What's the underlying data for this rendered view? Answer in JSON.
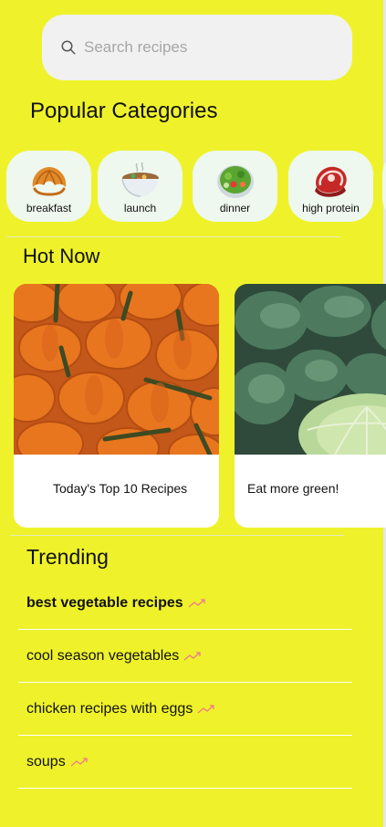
{
  "search": {
    "placeholder": "Search recipes",
    "icon": "search-icon"
  },
  "popular": {
    "title": "Popular Categories",
    "items": [
      {
        "label": "breakfast",
        "icon": "croissant-icon"
      },
      {
        "label": "launch",
        "icon": "soup-bowl-icon"
      },
      {
        "label": "dinner",
        "icon": "salad-icon"
      },
      {
        "label": "high protein",
        "icon": "steak-icon"
      }
    ]
  },
  "hot": {
    "title": "Hot Now",
    "cards": [
      {
        "title": "Today's Top 10 Recipes",
        "image": "pumpkins-image"
      },
      {
        "title": "Eat more green!",
        "image": "cabbage-image"
      }
    ]
  },
  "trending": {
    "title": "Trending",
    "items": [
      {
        "label": "best vegetable recipes"
      },
      {
        "label": "cool season vegetables"
      },
      {
        "label": "chicken recipes with eggs"
      },
      {
        "label": "soups"
      }
    ],
    "icon": "trending-up-icon",
    "accent": "#f07a8a"
  },
  "colors": {
    "background": "#eff22a",
    "card": "#ffffff",
    "category_bg": "#eef8ee"
  }
}
